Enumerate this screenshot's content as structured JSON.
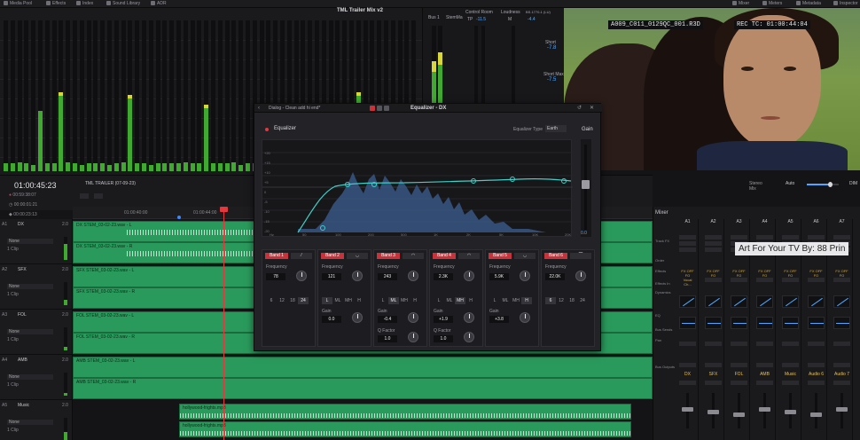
{
  "topbar": {
    "left_tabs": [
      "Media Pool",
      "Effects",
      "Index",
      "Sound Library",
      "ADR"
    ],
    "right_tabs": [
      "Mixer",
      "Meters",
      "Metadata",
      "Inspector"
    ]
  },
  "meters": {
    "title": "TML Trailer Mix v2",
    "bus_label": "Bus 1",
    "stem_label": "StemMa",
    "control_room": "Control Room",
    "tp_label": "TP",
    "tp_value": "-11.5",
    "loudness_label": "Loudness",
    "loudness_standard": "BS.1770-1 (LU)",
    "m_label": "M",
    "m_value": "-4.4",
    "short_label": "Short",
    "short_value": "-7.8",
    "short_max_label": "Short Max",
    "short_max_value": "-7.5"
  },
  "viewer": {
    "clip_name": "A009_C011_0129QC_001.R3D",
    "rec_tc": "REC TC: 01:00:44:04"
  },
  "timeline": {
    "timecode": "01:00:45:23",
    "rows": [
      "00:59:38:07",
      "00:00:01:21",
      "00:00:23:13"
    ],
    "name": "TML TRAILER (07-09-23)",
    "ruler": [
      "01:00:40:00",
      "01:00:44:00"
    ],
    "tracks": [
      {
        "id": "A1",
        "name": "DX",
        "ch": "2.0",
        "mode": "None",
        "clips": "1 Clip"
      },
      {
        "id": "A2",
        "name": "SFX",
        "ch": "2.0",
        "mode": "None",
        "clips": "1 Clip"
      },
      {
        "id": "A3",
        "name": "FOL",
        "ch": "2.0",
        "mode": "None",
        "clips": "1 Clip"
      },
      {
        "id": "A4",
        "name": "AMB",
        "ch": "2.0",
        "mode": "None",
        "clips": "1 Clip"
      },
      {
        "id": "A5",
        "name": "Music",
        "ch": "2.0",
        "mode": "None",
        "clips": "1 Clip"
      }
    ],
    "clip_labels": [
      "DX STEM_03-02-23.wav - L",
      "DX STEM_03-02-23.wav - R",
      "SFX STEM_03-02-23.wav - L",
      "SFX STEM_03-02-23.wav - R",
      "FOL STEM_03-02-23.wav - L",
      "FOL STEM_03-02-23.wav - R",
      "AMB STEM_03-02-23.wav - L",
      "AMB STEM_03-02-23.wav - R",
      "hollywood-frights.mp3",
      "hollywood-frights.mp3"
    ],
    "stereo_mix": "Stereo Mix",
    "auto": "Auto",
    "dim": "DIM"
  },
  "mixer": {
    "title": "Mixer",
    "columns": [
      "A1",
      "A2",
      "A3",
      "A4",
      "A5",
      "A6",
      "A7"
    ],
    "row_labels": [
      "Track FX",
      "Order",
      "Effects",
      "Effects In",
      "Dynamics",
      "EQ",
      "Bus Sends",
      "Pan",
      "Bus Outputs"
    ],
    "names": [
      "DX",
      "SFX",
      "FOL",
      "AMB",
      "Music",
      "Audio 6",
      "Audio 7"
    ],
    "fx": [
      "FX OFF FO",
      "FX OFF FO",
      "FX OFF FO",
      "FX OFF FO",
      "FX OFF FO",
      "FX OFF FO",
      "FX OFF FO"
    ],
    "vocal": "Vocal Ch..."
  },
  "tooltip": "Art For Your TV By: 88 Prin",
  "eq": {
    "title": "Equalizer - DX",
    "preset": "Dialog - Clean add hi end*",
    "label": "Equalizer",
    "type_label": "Equalizer Type",
    "type_value": "Earth",
    "gain_label": "Gain",
    "gain_value": "0.0",
    "bands": [
      {
        "name": "Band 1",
        "freq_label": "Frequency",
        "freq": "78",
        "opts": [
          "6",
          "12",
          "18",
          "24"
        ],
        "on": 3
      },
      {
        "name": "Band 2",
        "freq_label": "Frequency",
        "freq": "121",
        "opts": [
          "L",
          "ML",
          "MH",
          "H"
        ],
        "on": 0,
        "gain_label": "Gain",
        "gain": "0.0"
      },
      {
        "name": "Band 3",
        "freq_label": "Frequency",
        "freq": "243",
        "opts": [
          "L",
          "ML",
          "MH",
          "H"
        ],
        "on": 1,
        "gain_label": "Gain",
        "gain": "-0.4",
        "q_label": "Q Factor",
        "q": "1.0"
      },
      {
        "name": "Band 4",
        "freq_label": "Frequency",
        "freq": "2.3K",
        "opts": [
          "L",
          "ML",
          "MH",
          "H"
        ],
        "on": 2,
        "gain_label": "Gain",
        "gain": "+1.9",
        "q_label": "Q Factor",
        "q": "1.0"
      },
      {
        "name": "Band 5",
        "freq_label": "Frequency",
        "freq": "5.9K",
        "opts": [
          "L",
          "ML",
          "MH",
          "H"
        ],
        "on": 3,
        "gain_label": "Gain",
        "gain": "+3.8"
      },
      {
        "name": "Band 6",
        "freq_label": "Frequency",
        "freq": "22.0K",
        "opts": [
          "6",
          "12",
          "18",
          "24"
        ],
        "on": 0
      }
    ],
    "freq_axis": [
      "Hz",
      "50",
      "100",
      "200",
      "500",
      "1K",
      "2K",
      "5K",
      "10K",
      "20K"
    ],
    "db_axis": [
      "+20",
      "+15",
      "+10",
      "+5",
      "0",
      "-5",
      "-10",
      "-15",
      "-20"
    ]
  }
}
